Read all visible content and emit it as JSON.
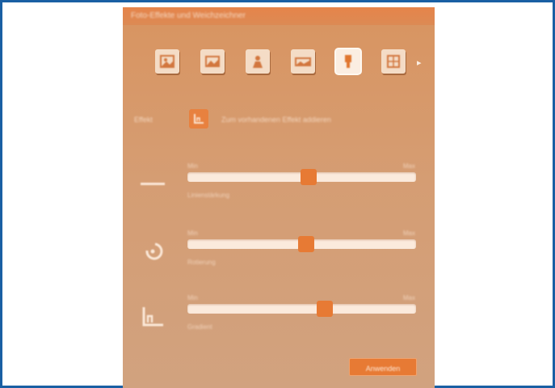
{
  "window": {
    "title": "Foto-Effekte und Weichzeichner"
  },
  "toolbar": {
    "tools": [
      {
        "icon": "picture-icon"
      },
      {
        "icon": "landscape-icon"
      },
      {
        "icon": "portrait-icon"
      },
      {
        "icon": "panorama-icon"
      },
      {
        "icon": "figure-icon",
        "active": true
      },
      {
        "icon": "grid-icon"
      }
    ],
    "next_label": "▸"
  },
  "option": {
    "label": "Effekt",
    "text": "Zum vorhandenen Effekt addieren"
  },
  "sliders": [
    {
      "icon": "line-icon",
      "min_label": "Min",
      "max_label": "Max",
      "value": 0.53,
      "caption": "Linienstärkung"
    },
    {
      "icon": "spiral-icon",
      "min_label": "Min",
      "max_label": "Max",
      "value": 0.52,
      "caption": "Rotierung"
    },
    {
      "icon": "chart-corner-icon",
      "min_label": "Min",
      "max_label": "Max",
      "value": 0.6,
      "caption": "Gradient"
    }
  ],
  "apply": {
    "label": "Anwenden"
  },
  "colors": {
    "accent": "#e77a34",
    "panel": "#d89a6c",
    "frame": "#1a5fa3"
  }
}
